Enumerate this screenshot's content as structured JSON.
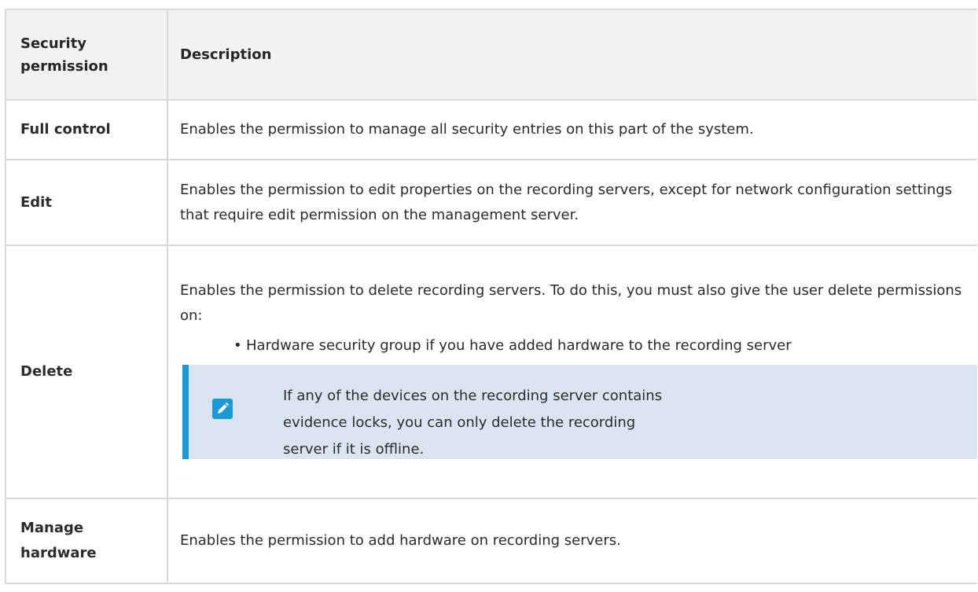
{
  "table": {
    "headers": {
      "col1": "Security permission",
      "col2": "Description"
    },
    "rows": [
      {
        "name": "Full control",
        "description": "Enables the permission to manage all security entries on this part of the system."
      },
      {
        "name": "Edit",
        "description": "Enables the permission to edit properties on the recording servers, except for network configuration settings that require edit permission on the management server."
      },
      {
        "name": "Delete",
        "description": "Enables the permission to delete recording servers. To do this, you must also give the user delete permissions on:",
        "bullets": [
          "Hardware security group if you have added hardware to the recording server"
        ],
        "note": {
          "icon": "pencil-note-icon",
          "text": "If any of the devices on the recording server contains evidence locks, you can only delete the recording server if it is offline."
        }
      },
      {
        "name": "Manage hardware",
        "description": "Enables the permission to add hardware on recording servers."
      }
    ]
  },
  "colors": {
    "header_bg": "#f2f2f2",
    "border": "#d9d9d9",
    "note_bg": "#dbe4f1",
    "accent": "#1a9bd7"
  }
}
